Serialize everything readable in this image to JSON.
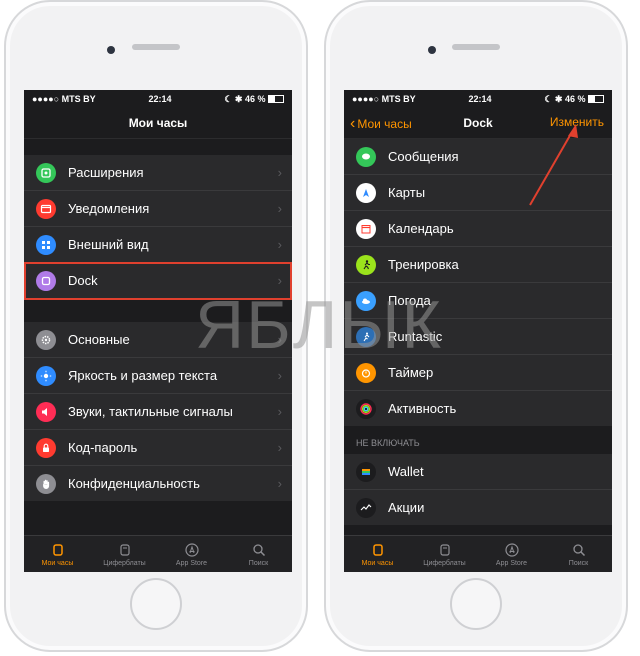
{
  "status_bar": {
    "left": "●●●●○ MTS BY",
    "time": "22:14",
    "right": "46 %"
  },
  "left_screen": {
    "title": "Мои часы",
    "group1": [
      {
        "label": "Расширения",
        "icon": "extensions-icon",
        "color": "#34c759"
      },
      {
        "label": "Уведомления",
        "icon": "notifications-icon",
        "color": "#ff3b30"
      },
      {
        "label": "Внешний вид",
        "icon": "appearance-icon",
        "color": "#2f8cff"
      },
      {
        "label": "Dock",
        "icon": "dock-icon",
        "color": "#b07be8"
      }
    ],
    "group2": [
      {
        "label": "Основные",
        "icon": "gear-icon",
        "color": "#8e8e93"
      },
      {
        "label": "Яркость и размер текста",
        "icon": "brightness-icon",
        "color": "#2f8cff"
      },
      {
        "label": "Звуки, тактильные сигналы",
        "icon": "sounds-icon",
        "color": "#ff2d55"
      },
      {
        "label": "Код-пароль",
        "icon": "lock-icon",
        "color": "#ff3b30"
      },
      {
        "label": "Конфиденциальность",
        "icon": "hand-icon",
        "color": "#8e8e93"
      }
    ]
  },
  "right_screen": {
    "back_label": "Мои часы",
    "title": "Dock",
    "edit_label": "Изменить",
    "items": [
      {
        "label": "Сообщения",
        "icon": "messages-icon",
        "color": "#34c759"
      },
      {
        "label": "Карты",
        "icon": "maps-icon",
        "color": "#ffffff"
      },
      {
        "label": "Календарь",
        "icon": "calendar-icon",
        "color": "#ffffff"
      },
      {
        "label": "Тренировка",
        "icon": "workout-icon",
        "color": "#9be31c"
      },
      {
        "label": "Погода",
        "icon": "weather-icon",
        "color": "#3aa0ff"
      },
      {
        "label": "Runtastic",
        "icon": "runtastic-icon",
        "color": "#2d6fb5"
      },
      {
        "label": "Таймер",
        "icon": "timer-icon",
        "color": "#ff9500"
      },
      {
        "label": "Активность",
        "icon": "activity-icon",
        "color": "#1c1c1e"
      }
    ],
    "section_header": "НЕ ВКЛЮЧАТЬ",
    "excluded": [
      {
        "label": "Wallet",
        "icon": "wallet-icon",
        "color": "#1c1c1e"
      },
      {
        "label": "Акции",
        "icon": "stocks-icon",
        "color": "#1c1c1e"
      }
    ]
  },
  "tabbar": {
    "my_watch": "Мои часы",
    "faces": "Циферблаты",
    "app_store": "App Store",
    "search": "Поиск"
  },
  "watermark": "ЯБЛЫК",
  "colors": {
    "accent": "#ff9500",
    "highlight": "#e0402e"
  }
}
